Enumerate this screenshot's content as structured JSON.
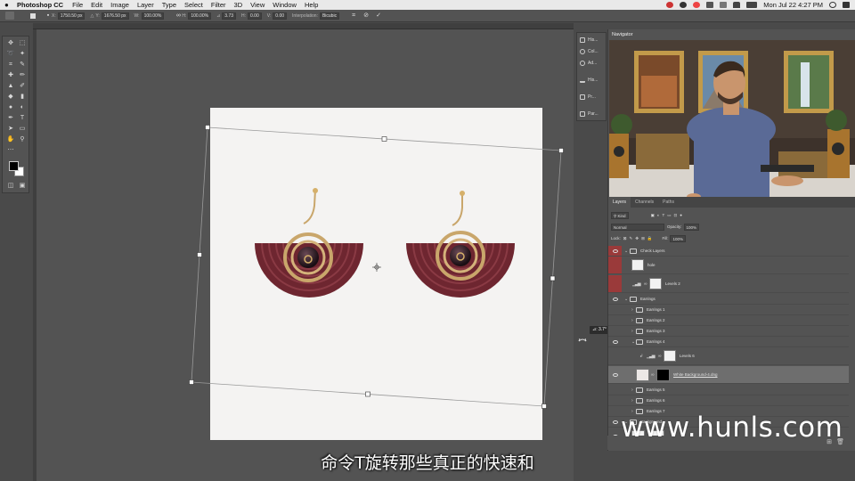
{
  "menubar": {
    "app_name": "Photoshop CC",
    "items": [
      "File",
      "Edit",
      "Image",
      "Layer",
      "Type",
      "Select",
      "Filter",
      "3D",
      "View",
      "Window",
      "Help"
    ],
    "datetime": "Mon Jul 22  4:27 PM"
  },
  "options_bar": {
    "x_label": "X:",
    "x_value": "1750.50 px",
    "y_label": "Y:",
    "y_value": "1676.50 px",
    "w_label": "W:",
    "w_value": "100.00%",
    "h_label": "H:",
    "h_value": "100.00%",
    "angle_value": "3.73",
    "hskew_label": "H:",
    "hskew_value": "0.00",
    "vskew_label": "V:",
    "vskew_value": "0.00",
    "interp_label": "Interpolation:",
    "interp_value": "Bicubic"
  },
  "transform": {
    "angle_badge": "⊿: 3.7°"
  },
  "navigator": {
    "title": "Navigator"
  },
  "mini_panels": [
    "His...",
    "Col...",
    "Ad...",
    "His...",
    "Pr...",
    "Par..."
  ],
  "layers_panel": {
    "tabs": [
      "Layers",
      "Channels",
      "Paths"
    ],
    "kind_label": "Kind",
    "blend_mode": "Normal",
    "opacity_label": "Opacity:",
    "opacity_value": "100%",
    "lock_label": "Lock:",
    "fill_label": "Fill:",
    "fill_value": "100%",
    "layers": [
      {
        "name": "Check Layers",
        "type": "group",
        "indent": 0,
        "red": true
      },
      {
        "name": "hole",
        "type": "layer",
        "indent": 1,
        "red": true
      },
      {
        "name": "Levels 2",
        "type": "adjustment",
        "indent": 1,
        "red": true
      },
      {
        "name": "Earrings",
        "type": "group",
        "indent": 0
      },
      {
        "name": "Earrings 1",
        "type": "group",
        "indent": 1
      },
      {
        "name": "Earrings 2",
        "type": "group",
        "indent": 1
      },
      {
        "name": "Earrings 3",
        "type": "group",
        "indent": 1
      },
      {
        "name": "Earrings 4",
        "type": "group",
        "indent": 1,
        "open": true
      },
      {
        "name": "Levels 6",
        "type": "adjustment",
        "indent": 2
      },
      {
        "name": "White Background-4.dng",
        "type": "smart",
        "indent": 2,
        "selected": true
      },
      {
        "name": "Earrings 5",
        "type": "group",
        "indent": 1
      },
      {
        "name": "Earrings 6",
        "type": "group",
        "indent": 1
      },
      {
        "name": "Earrings 7",
        "type": "group",
        "indent": 1
      },
      {
        "name": "Background",
        "type": "group",
        "indent": 0
      }
    ]
  },
  "watermark": "www.hunls.com",
  "subtitle": "命令T旋转那些真正的快速和"
}
